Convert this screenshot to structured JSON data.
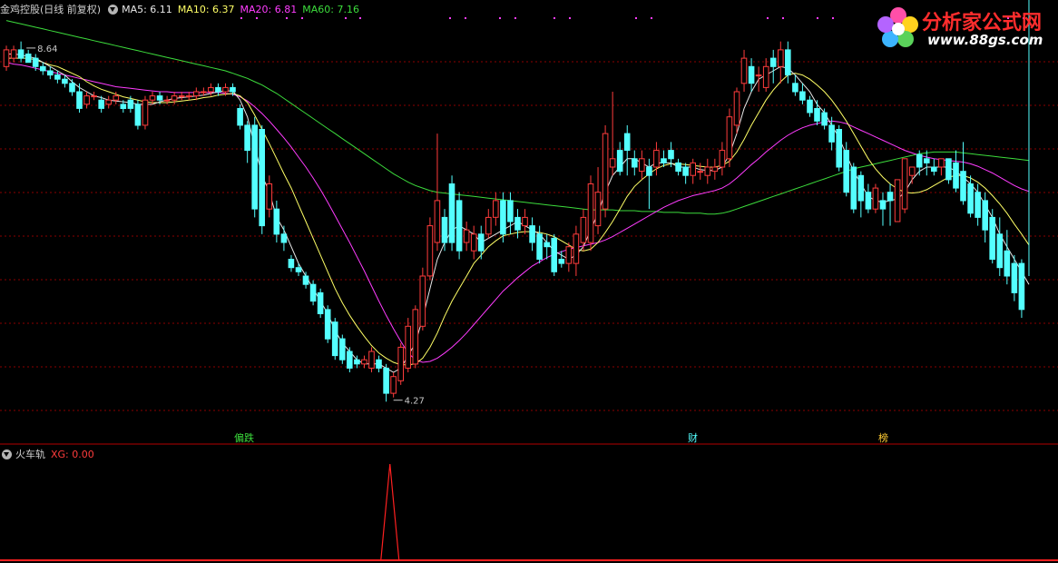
{
  "header": {
    "title": "金鸡控股(日线 前复权)",
    "ma5": "MA5: 6.11",
    "ma10": "MA10: 6.37",
    "ma20": "MA20: 6.81",
    "ma60": "MA60: 7.16"
  },
  "sub_header": {
    "title": "火车轨",
    "xg": "XG: 0.00"
  },
  "logo": {
    "name": "分析家公式网",
    "url": "www.88gs.com"
  },
  "annotations": {
    "high": "8.64",
    "low": "4.27",
    "marker1": "偏跌",
    "marker2": "财",
    "marker3": "榜"
  },
  "colors": {
    "up": "#ff3c3c",
    "down": "#54ffff",
    "ma5": "#e8e8e8",
    "ma10": "#ffff66",
    "ma20": "#ff3cff",
    "ma60": "#3cdc3c",
    "grid": "#8b0000"
  },
  "chart_data": {
    "type": "candlestick",
    "ylim": [
      4.0,
      8.9
    ],
    "x": [
      1,
      2,
      3,
      4,
      5,
      6,
      7,
      8,
      9,
      10,
      11,
      12,
      13,
      14,
      15,
      16,
      17,
      18,
      19,
      20,
      21,
      22,
      23,
      24,
      25,
      26,
      27,
      28,
      29,
      30,
      31,
      32,
      33,
      34,
      35,
      36,
      37,
      38,
      39,
      40,
      41,
      42,
      43,
      44,
      45,
      46,
      47,
      48,
      49,
      50,
      51,
      52,
      53,
      54,
      55,
      56,
      57,
      58,
      59,
      60,
      61,
      62,
      63,
      64,
      65,
      66,
      67,
      68,
      69,
      70,
      71,
      72,
      73,
      74,
      75,
      76,
      77,
      78,
      79,
      80,
      81,
      82,
      83,
      84,
      85,
      86,
      87,
      88,
      89,
      90,
      91,
      92,
      93,
      94,
      95,
      96,
      97,
      98,
      99,
      100,
      101,
      102,
      103,
      104,
      105,
      106,
      107,
      108,
      109,
      110,
      111,
      112,
      113,
      114,
      115,
      116,
      117,
      118,
      119,
      120,
      121,
      122,
      123,
      124,
      125,
      126,
      127,
      128,
      129,
      130,
      131,
      132,
      133,
      134,
      135,
      136,
      137,
      138,
      139,
      140,
      141
    ],
    "open": [
      8.3,
      8.4,
      8.5,
      8.45,
      8.4,
      8.3,
      8.25,
      8.2,
      8.15,
      8.1,
      8.0,
      7.85,
      7.95,
      7.9,
      7.85,
      7.9,
      7.85,
      7.9,
      7.85,
      7.6,
      7.9,
      7.95,
      7.9,
      7.9,
      7.95,
      7.95,
      7.95,
      8.0,
      8.0,
      8.05,
      8.0,
      8.05,
      7.8,
      7.6,
      7.6,
      7.55,
      6.6,
      6.6,
      6.3,
      6.0,
      5.9,
      5.8,
      5.7,
      5.6,
      5.4,
      5.25,
      5.05,
      4.9,
      4.8,
      4.75,
      4.7,
      4.8,
      4.7,
      4.4,
      4.55,
      4.7,
      4.75,
      5.2,
      5.8,
      6.2,
      6.5,
      6.9,
      6.7,
      6.2,
      6.1,
      6.3,
      6.3,
      6.5,
      6.7,
      6.7,
      6.5,
      6.4,
      6.4,
      6.3,
      6.2,
      6.25,
      6.0,
      5.95,
      5.95,
      6.2,
      6.2,
      6.4,
      6.6,
      7.1,
      7.3,
      7.5,
      7.2,
      7.05,
      7.1,
      7.1,
      7.2,
      7.3,
      7.15,
      7.1,
      7.0,
      7.05,
      7.0,
      7.05,
      7.1,
      7.2,
      7.6,
      8.1,
      8.3,
      8.2,
      8.05,
      8.4,
      8.3,
      8.5,
      8.1,
      8.0,
      7.9,
      7.8,
      7.75,
      7.6,
      7.55,
      7.3,
      7.1,
      7.0,
      6.8,
      6.6,
      6.7,
      6.8,
      6.45,
      6.6,
      7.0,
      7.25,
      7.2,
      7.1,
      7.1,
      7.2,
      7.15,
      7.05,
      6.9,
      6.8,
      6.7,
      6.5,
      6.3,
      6.1,
      5.95,
      5.95,
      5.75
    ],
    "close": [
      8.5,
      8.5,
      8.4,
      8.35,
      8.3,
      8.25,
      8.2,
      8.15,
      8.1,
      8.0,
      7.8,
      7.95,
      7.95,
      7.8,
      7.9,
      7.95,
      7.8,
      7.8,
      7.6,
      7.9,
      7.95,
      7.9,
      7.9,
      7.95,
      7.95,
      7.95,
      8.0,
      8.0,
      8.05,
      8.0,
      8.05,
      8.0,
      7.6,
      7.3,
      6.6,
      6.4,
      6.9,
      6.3,
      6.2,
      5.9,
      5.85,
      5.7,
      5.5,
      5.35,
      5.05,
      4.85,
      4.8,
      4.7,
      4.75,
      4.8,
      4.9,
      4.7,
      4.4,
      4.6,
      4.95,
      5.2,
      5.4,
      5.8,
      6.4,
      6.7,
      6.2,
      6.2,
      6.1,
      6.35,
      6.3,
      6.1,
      6.5,
      6.7,
      6.3,
      6.45,
      6.35,
      6.5,
      6.2,
      6.0,
      6.15,
      5.85,
      5.95,
      6.15,
      6.3,
      6.5,
      6.9,
      6.8,
      7.5,
      7.2,
      7.05,
      7.3,
      7.1,
      7.2,
      7.0,
      7.3,
      7.15,
      7.2,
      7.05,
      7.0,
      7.15,
      7.05,
      7.1,
      7.1,
      7.3,
      7.7,
      8.0,
      8.4,
      8.1,
      8.2,
      8.3,
      8.3,
      8.5,
      8.2,
      8.0,
      7.9,
      7.75,
      7.65,
      7.6,
      7.4,
      7.1,
      6.8,
      6.6,
      6.7,
      6.6,
      6.85,
      6.6,
      6.7,
      6.95,
      7.2,
      7.1,
      7.1,
      7.15,
      7.05,
      7.2,
      6.95,
      6.85,
      6.7,
      6.55,
      6.5,
      6.35,
      6.0,
      5.9,
      5.8,
      5.6,
      5.4
    ],
    "high": [
      8.55,
      8.55,
      8.6,
      8.5,
      8.45,
      8.35,
      8.3,
      8.25,
      8.2,
      8.15,
      8.1,
      8.0,
      8.0,
      7.95,
      7.95,
      8.0,
      7.9,
      7.95,
      7.9,
      7.95,
      8.0,
      8.0,
      7.95,
      8.0,
      8.0,
      8.0,
      8.05,
      8.05,
      8.1,
      8.1,
      8.1,
      8.1,
      7.85,
      7.65,
      7.7,
      7.6,
      7.0,
      6.7,
      6.4,
      6.05,
      5.95,
      5.85,
      5.75,
      5.65,
      5.45,
      5.3,
      5.1,
      4.95,
      4.85,
      4.85,
      4.95,
      4.85,
      4.75,
      4.65,
      5.0,
      5.3,
      5.45,
      5.9,
      6.5,
      7.5,
      6.6,
      7.0,
      6.8,
      6.45,
      6.4,
      6.4,
      6.6,
      6.8,
      6.8,
      6.8,
      6.6,
      6.6,
      6.5,
      6.4,
      6.3,
      6.3,
      6.1,
      6.2,
      6.4,
      6.6,
      7.0,
      7.1,
      7.6,
      8.0,
      7.4,
      7.6,
      7.3,
      7.3,
      7.2,
      7.4,
      7.3,
      7.4,
      7.2,
      7.15,
      7.2,
      7.15,
      7.2,
      7.2,
      7.4,
      7.8,
      8.05,
      8.5,
      8.4,
      8.3,
      8.4,
      8.5,
      8.6,
      8.6,
      8.2,
      8.1,
      7.95,
      7.9,
      7.8,
      7.7,
      7.6,
      7.4,
      7.15,
      7.05,
      6.9,
      6.9,
      6.8,
      6.9,
      6.7,
      6.9,
      7.1,
      7.3,
      7.3,
      7.2,
      7.2,
      7.2,
      7.3,
      7.4,
      7.0,
      6.9,
      6.8,
      6.6,
      6.5,
      6.35,
      6.05,
      6.0,
      5.8
    ],
    "low": [
      8.25,
      8.35,
      8.35,
      8.35,
      8.25,
      8.2,
      8.15,
      8.1,
      8.05,
      7.95,
      7.75,
      7.8,
      7.9,
      7.75,
      7.8,
      7.85,
      7.75,
      7.75,
      7.55,
      7.55,
      7.85,
      7.85,
      7.85,
      7.85,
      7.9,
      7.9,
      7.9,
      7.95,
      7.95,
      7.95,
      7.95,
      7.95,
      7.55,
      7.15,
      6.5,
      6.3,
      6.5,
      6.2,
      6.1,
      5.85,
      5.8,
      5.65,
      5.45,
      5.3,
      5.0,
      4.8,
      4.75,
      4.65,
      4.7,
      4.7,
      4.65,
      4.65,
      4.3,
      4.35,
      4.5,
      4.65,
      4.7,
      5.15,
      5.75,
      6.1,
      6.1,
      6.1,
      6.0,
      6.1,
      6.0,
      6.0,
      6.25,
      6.4,
      6.2,
      6.3,
      6.25,
      6.3,
      6.1,
      5.95,
      6.0,
      5.8,
      5.9,
      5.85,
      5.8,
      6.1,
      6.1,
      6.3,
      6.5,
      7.0,
      7.0,
      7.0,
      7.0,
      6.95,
      6.6,
      7.0,
      7.1,
      7.1,
      7.0,
      6.9,
      6.9,
      6.95,
      6.9,
      6.95,
      7.0,
      7.1,
      7.5,
      8.0,
      8.0,
      8.0,
      8.0,
      8.1,
      8.1,
      8.1,
      7.95,
      7.85,
      7.7,
      7.6,
      7.55,
      7.3,
      7.05,
      6.75,
      6.55,
      6.5,
      6.55,
      6.55,
      6.4,
      6.4,
      6.45,
      6.55,
      6.9,
      7.0,
      7.0,
      7.0,
      7.0,
      6.9,
      6.8,
      6.65,
      6.5,
      6.4,
      6.2,
      5.95,
      5.8,
      5.7,
      5.5,
      5.3
    ],
    "ma5": [
      8.45,
      8.45,
      8.44,
      8.42,
      8.4,
      8.35,
      8.3,
      8.25,
      8.2,
      8.12,
      8.05,
      8.0,
      7.95,
      7.93,
      7.9,
      7.89,
      7.88,
      7.87,
      7.85,
      7.85,
      7.85,
      7.88,
      7.9,
      7.92,
      7.93,
      7.94,
      7.95,
      7.96,
      7.98,
      8.0,
      8.01,
      8.01,
      7.9,
      7.7,
      7.35,
      7.0,
      6.8,
      6.5,
      6.35,
      6.15,
      5.95,
      5.8,
      5.65,
      5.5,
      5.35,
      5.15,
      5.0,
      4.9,
      4.8,
      4.75,
      4.75,
      4.75,
      4.7,
      4.65,
      4.7,
      4.85,
      5.0,
      5.3,
      5.65,
      6.0,
      6.2,
      6.35,
      6.4,
      6.35,
      6.3,
      6.2,
      6.25,
      6.3,
      6.35,
      6.4,
      6.45,
      6.4,
      6.35,
      6.3,
      6.2,
      6.1,
      6.05,
      6.0,
      6.05,
      6.15,
      6.35,
      6.55,
      6.8,
      7.0,
      7.1,
      7.2,
      7.2,
      7.15,
      7.1,
      7.15,
      7.15,
      7.15,
      7.1,
      7.1,
      7.1,
      7.07,
      7.06,
      7.06,
      7.1,
      7.25,
      7.5,
      7.8,
      8.0,
      8.15,
      8.2,
      8.25,
      8.3,
      8.28,
      8.2,
      8.1,
      8.0,
      7.85,
      7.75,
      7.6,
      7.45,
      7.25,
      7.05,
      6.9,
      6.75,
      6.7,
      6.68,
      6.7,
      6.72,
      6.8,
      6.95,
      7.05,
      7.1,
      7.1,
      7.1,
      7.1,
      7.05,
      6.98,
      6.9,
      6.8,
      6.65,
      6.5,
      6.3,
      6.15,
      6.0,
      5.85,
      5.7
    ],
    "ma10": [
      8.4,
      8.4,
      8.4,
      8.4,
      8.38,
      8.35,
      8.32,
      8.3,
      8.26,
      8.22,
      8.18,
      8.12,
      8.07,
      8.03,
      8.0,
      7.97,
      7.94,
      7.92,
      7.9,
      7.88,
      7.87,
      7.87,
      7.87,
      7.88,
      7.89,
      7.9,
      7.91,
      7.93,
      7.94,
      7.96,
      7.97,
      7.98,
      7.95,
      7.87,
      7.72,
      7.55,
      7.38,
      7.2,
      7.02,
      6.85,
      6.65,
      6.45,
      6.25,
      6.05,
      5.85,
      5.65,
      5.48,
      5.33,
      5.2,
      5.08,
      4.97,
      4.88,
      4.82,
      4.77,
      4.74,
      4.74,
      4.75,
      4.82,
      4.95,
      5.12,
      5.32,
      5.5,
      5.65,
      5.8,
      5.95,
      6.05,
      6.15,
      6.22,
      6.28,
      6.3,
      6.32,
      6.33,
      6.33,
      6.32,
      6.3,
      6.27,
      6.22,
      6.17,
      6.12,
      6.1,
      6.12,
      6.2,
      6.32,
      6.45,
      6.6,
      6.75,
      6.87,
      6.95,
      7.02,
      7.08,
      7.12,
      7.14,
      7.14,
      7.13,
      7.12,
      7.11,
      7.1,
      7.1,
      7.12,
      7.17,
      7.28,
      7.43,
      7.6,
      7.75,
      7.9,
      8.02,
      8.12,
      8.2,
      8.22,
      8.2,
      8.15,
      8.08,
      8.0,
      7.9,
      7.78,
      7.65,
      7.5,
      7.35,
      7.2,
      7.08,
      6.98,
      6.9,
      6.84,
      6.8,
      6.79,
      6.8,
      6.83,
      6.88,
      6.93,
      6.98,
      7.0,
      7.0,
      6.97,
      6.92,
      6.85,
      6.76,
      6.66,
      6.55,
      6.42,
      6.3,
      6.17
    ],
    "ma20": [
      8.35,
      8.33,
      8.32,
      8.3,
      8.28,
      8.26,
      8.24,
      8.22,
      8.2,
      8.18,
      8.16,
      8.14,
      8.12,
      8.1,
      8.08,
      8.06,
      8.05,
      8.04,
      8.03,
      8.02,
      8.01,
      8.0,
      8.0,
      7.99,
      7.99,
      7.99,
      7.99,
      7.99,
      7.99,
      7.99,
      7.98,
      7.97,
      7.94,
      7.89,
      7.82,
      7.74,
      7.65,
      7.55,
      7.45,
      7.34,
      7.22,
      7.1,
      6.97,
      6.83,
      6.68,
      6.52,
      6.36,
      6.2,
      6.03,
      5.86,
      5.68,
      5.5,
      5.33,
      5.17,
      5.02,
      4.88,
      4.8,
      4.77,
      4.78,
      4.82,
      4.88,
      4.95,
      5.03,
      5.12,
      5.22,
      5.32,
      5.42,
      5.52,
      5.62,
      5.7,
      5.78,
      5.85,
      5.92,
      5.97,
      6.02,
      6.06,
      6.09,
      6.12,
      6.14,
      6.16,
      6.18,
      6.2,
      6.23,
      6.27,
      6.32,
      6.37,
      6.42,
      6.47,
      6.52,
      6.57,
      6.62,
      6.66,
      6.7,
      6.73,
      6.76,
      6.78,
      6.8,
      6.82,
      6.85,
      6.9,
      6.97,
      7.05,
      7.13,
      7.2,
      7.28,
      7.35,
      7.42,
      7.48,
      7.53,
      7.57,
      7.6,
      7.62,
      7.64,
      7.65,
      7.64,
      7.62,
      7.58,
      7.54,
      7.5,
      7.46,
      7.42,
      7.38,
      7.34,
      7.3,
      7.27,
      7.24,
      7.22,
      7.2,
      7.19,
      7.18,
      7.17,
      7.16,
      7.14,
      7.11,
      7.07,
      7.03,
      6.98,
      6.93,
      6.88,
      6.84,
      6.81
    ],
    "ma60": [
      8.85,
      8.83,
      8.81,
      8.79,
      8.77,
      8.75,
      8.73,
      8.71,
      8.69,
      8.67,
      8.65,
      8.63,
      8.61,
      8.59,
      8.57,
      8.55,
      8.53,
      8.51,
      8.49,
      8.47,
      8.45,
      8.43,
      8.41,
      8.39,
      8.37,
      8.35,
      8.33,
      8.31,
      8.29,
      8.27,
      8.25,
      8.22,
      8.19,
      8.16,
      8.12,
      8.08,
      8.03,
      7.98,
      7.92,
      7.86,
      7.8,
      7.74,
      7.68,
      7.62,
      7.56,
      7.5,
      7.44,
      7.38,
      7.32,
      7.26,
      7.2,
      7.14,
      7.08,
      7.02,
      6.97,
      6.92,
      6.88,
      6.85,
      6.82,
      6.8,
      6.79,
      6.78,
      6.77,
      6.76,
      6.75,
      6.74,
      6.73,
      6.72,
      6.71,
      6.7,
      6.69,
      6.68,
      6.67,
      6.66,
      6.65,
      6.64,
      6.63,
      6.62,
      6.61,
      6.6,
      6.59,
      6.59,
      6.59,
      6.59,
      6.58,
      6.58,
      6.58,
      6.57,
      6.57,
      6.57,
      6.56,
      6.56,
      6.56,
      6.55,
      6.55,
      6.55,
      6.54,
      6.54,
      6.55,
      6.57,
      6.6,
      6.63,
      6.66,
      6.69,
      6.72,
      6.75,
      6.78,
      6.81,
      6.84,
      6.87,
      6.9,
      6.93,
      6.96,
      6.99,
      7.02,
      7.05,
      7.08,
      7.1,
      7.12,
      7.14,
      7.16,
      7.18,
      7.2,
      7.22,
      7.24,
      7.26,
      7.27,
      7.28,
      7.28,
      7.28,
      7.28,
      7.27,
      7.26,
      7.25,
      7.24,
      7.23,
      7.22,
      7.21,
      7.2,
      7.19,
      7.18
    ],
    "xg": {
      "spike_index": 55,
      "spike_value": 1.0,
      "value": 0.0
    },
    "high_index": 3,
    "low_index": 53
  }
}
